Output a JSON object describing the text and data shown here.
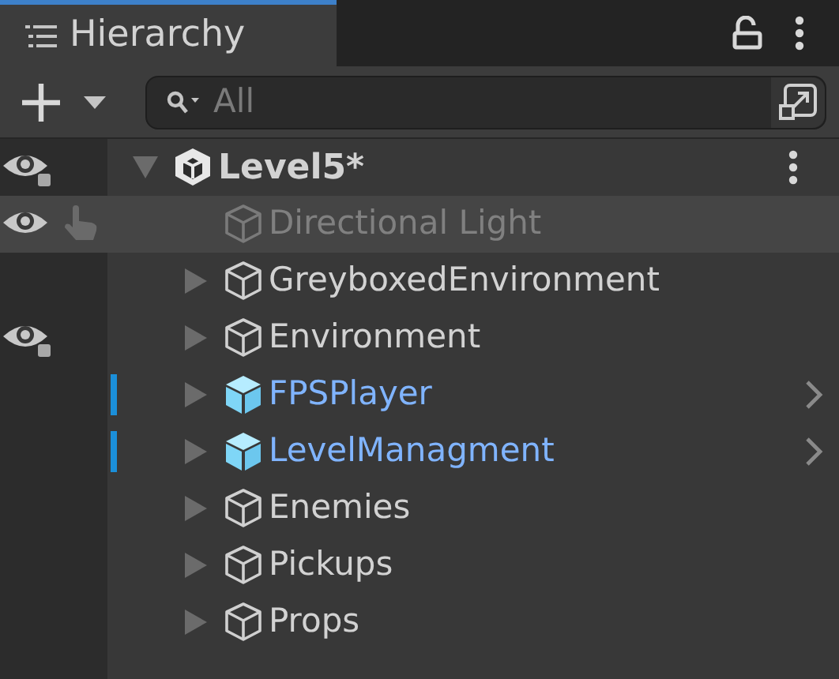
{
  "tab": {
    "title": "Hierarchy",
    "selected": true
  },
  "toolbar": {
    "search": {
      "placeholder": "All"
    }
  },
  "tree": [
    {
      "kind": "scene",
      "name": "Level5*",
      "expanded": true,
      "visible": true,
      "mixed": true,
      "children": [
        {
          "kind": "object",
          "name": "Directional Light",
          "disabled": true,
          "hovered": true,
          "visible": true,
          "pick_hand": true
        },
        {
          "kind": "object",
          "name": "GreyboxedEnvironment",
          "expandable": true
        },
        {
          "kind": "object",
          "name": "Environment",
          "expandable": true,
          "visible": true,
          "mixed": true
        },
        {
          "kind": "prefab",
          "name": "FPSPlayer",
          "expandable": true,
          "overridden": true
        },
        {
          "kind": "prefab",
          "name": "LevelManagment",
          "expandable": true,
          "overridden": true
        },
        {
          "kind": "object",
          "name": "Enemies",
          "expandable": true
        },
        {
          "kind": "object",
          "name": "Pickups",
          "expandable": true
        },
        {
          "kind": "object",
          "name": "Props",
          "expandable": true
        }
      ]
    }
  ]
}
